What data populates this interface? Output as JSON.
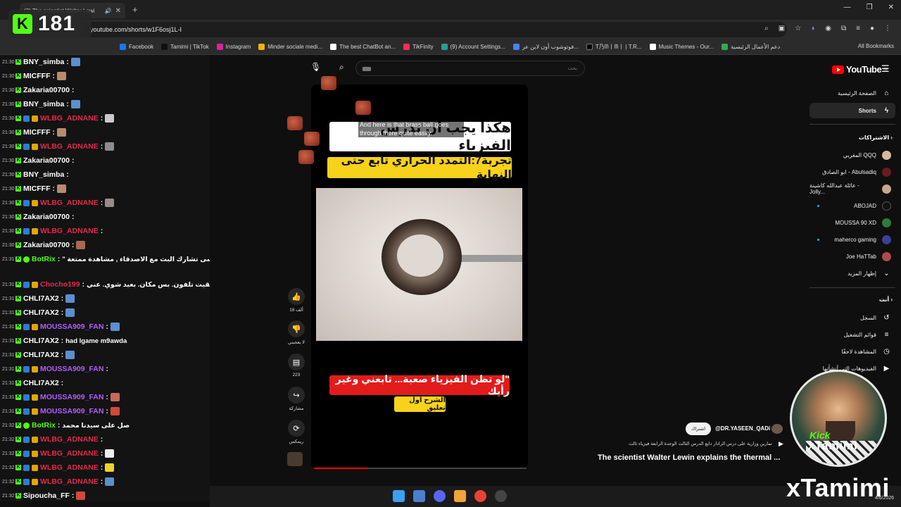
{
  "browser": {
    "tab_title": "(3) The scientist Walter Lewi",
    "url": "youtube.com/shorts/w1F6osj1L-I",
    "bookmarks": [
      "Facebook",
      "Tamimi | TikTok",
      "Instagram",
      "Minder sociale medi...",
      "The best ChatBot an...",
      "TikFinity",
      "(9) Account Settings...",
      "فوتوشوب أون لاين عر...",
      "T乃ᗰ丨ᗰ丨 | T.R...",
      "Music Themes - Our...",
      "دعم الأعمال الرئيسية"
    ],
    "all_bookmarks": "All Bookmarks"
  },
  "kick_badge": {
    "logo": "K",
    "viewers": "181"
  },
  "chat": [
    {
      "time": "21:30",
      "user": "BNY_simba",
      "color": "#ffffff",
      "text": "",
      "badges": 1,
      "emote": "#5b8fd1"
    },
    {
      "time": "21:30",
      "user": "MICFFF",
      "color": "#ffffff",
      "text": "",
      "badges": 1,
      "emote": "#b98a6d"
    },
    {
      "time": "21:30",
      "user": "Zakaria00700",
      "color": "#ffffff",
      "text": "",
      "badges": 1,
      "emote": ""
    },
    {
      "time": "21:30",
      "user": "BNY_simba",
      "color": "#ffffff",
      "text": "",
      "badges": 1,
      "emote": "#5b8fd1"
    },
    {
      "time": "21:30",
      "user": "WLBG_ADNANE",
      "color": "#e7284a",
      "text": "",
      "badges": 3,
      "emote": "#c9c9c9"
    },
    {
      "time": "21:30",
      "user": "MICFFF",
      "color": "#ffffff",
      "text": "",
      "badges": 1,
      "emote": "#b98a6d"
    },
    {
      "time": "21:30",
      "user": "WLBG_ADNANE",
      "color": "#e7284a",
      "text": "",
      "badges": 3,
      "emote": "#8c8c8c"
    },
    {
      "time": "21:30",
      "user": "Zakaria00700",
      "color": "#ffffff",
      "text": "",
      "badges": 1,
      "emote": ""
    },
    {
      "time": "21:30",
      "user": "BNY_simba",
      "color": "#ffffff",
      "text": "",
      "badges": 1,
      "emote": ""
    },
    {
      "time": "21:30",
      "user": "MICFFF",
      "color": "#ffffff",
      "text": "",
      "badges": 1,
      "emote": "#b98a6d"
    },
    {
      "time": "21:30",
      "user": "WLBG_ADNANE",
      "color": "#e7284a",
      "text": "",
      "badges": 3,
      "emote": "#9a8a8a"
    },
    {
      "time": "21:30",
      "user": "Zakaria00700",
      "color": "#ffffff",
      "text": "",
      "badges": 1,
      "emote": ""
    },
    {
      "time": "21:30",
      "user": "WLBG_ADNANE",
      "color": "#e7284a",
      "text": "",
      "badges": 3,
      "emote": ""
    },
    {
      "time": "21:30",
      "user": "Zakaria00700",
      "color": "#ffffff",
      "text": "",
      "badges": 1,
      "emote": "#a8694f"
    },
    {
      "time": "21:31",
      "user": "BotRix",
      "color": "#53fc18",
      "text": "\" ما تنسى تشارك البث مع الاصدقاء , مشاهدة ممتعة",
      "badges": 2,
      "emote": ""
    },
    {
      "time": "21:31",
      "user": "Chocho199",
      "color": "#e7284a",
      "text": "لقيت تلفون. بس مكان. بعيد شوي. عني",
      "badges": 3,
      "emote": ""
    },
    {
      "time": "21:31",
      "user": "CHLI7AX2",
      "color": "#ffffff",
      "text": "",
      "badges": 1,
      "emote": "#5b8fd1"
    },
    {
      "time": "21:31",
      "user": "CHLI7AX2",
      "color": "#ffffff",
      "text": "",
      "badges": 1,
      "emote": "#5b8fd1"
    },
    {
      "time": "21:31",
      "user": "MOUSSA909_FAN",
      "color": "#b45cff",
      "text": "",
      "badges": 4,
      "emote": "#5b8fd1"
    },
    {
      "time": "21:31",
      "user": "CHLI7AX2",
      "color": "#ffffff",
      "text": "had lgame m9awda",
      "badges": 1,
      "emote": ""
    },
    {
      "time": "21:31",
      "user": "CHLI7AX2",
      "color": "#ffffff",
      "text": "",
      "badges": 1,
      "emote": "#5b8fd1"
    },
    {
      "time": "21:31",
      "user": "MOUSSA909_FAN",
      "color": "#b45cff",
      "text": "",
      "badges": 4,
      "emote": ""
    },
    {
      "time": "21:31",
      "user": "CHLI7AX2",
      "color": "#ffffff",
      "text": "",
      "badges": 1,
      "emote": ""
    },
    {
      "time": "21:31",
      "user": "MOUSSA909_FAN",
      "color": "#b45cff",
      "text": "",
      "badges": 4,
      "emote": "#c76a56"
    },
    {
      "time": "21:31",
      "user": "MOUSSA909_FAN",
      "color": "#b45cff",
      "text": "",
      "badges": 4,
      "emote": "#d14a3a"
    },
    {
      "time": "21:32",
      "user": "BotRix",
      "color": "#53fc18",
      "text": "صل على سيدنا محمد",
      "badges": 2,
      "emote": ""
    },
    {
      "time": "21:32",
      "user": "WLBG_ADNANE",
      "color": "#e7284a",
      "text": "",
      "badges": 3,
      "emote": ""
    },
    {
      "time": "21:32",
      "user": "WLBG_ADNANE",
      "color": "#e7284a",
      "text": "",
      "badges": 3,
      "emote": "#eeeeee"
    },
    {
      "time": "21:32",
      "user": "WLBG_ADNANE",
      "color": "#e7284a",
      "text": "",
      "badges": 3,
      "emote": "#f2d12a"
    },
    {
      "time": "21:32",
      "user": "WLBG_ADNANE",
      "color": "#e7284a",
      "text": "",
      "badges": 3,
      "emote": "#5b8fd1"
    },
    {
      "time": "21:32",
      "user": "Sipoucha_FF",
      "color": "#ffffff",
      "text": "",
      "badges": 1,
      "emote": "#d14a3a"
    }
  ],
  "youtube": {
    "logo": "YouTube",
    "logo_region": "BE",
    "search_placeholder": "بحث",
    "sidebar": {
      "home": "الصفحة الرئيسية",
      "shorts": "Shorts",
      "subscriptions_head": "الاشتراكات",
      "channels": [
        "المغربي QQQ",
        "ابو الصادق - Abulsadiq",
        "عائلة عبدالله كاشينة - Jolly...",
        "ABOJAD",
        "MOUSSA 90 XD",
        "maherco gaming",
        "Joe HaTTab"
      ],
      "show_more": "إظهار المزيد",
      "you_head": "أنت",
      "history": "السجل",
      "playlists": "قوائم التشغيل",
      "watch_later": "المشاهدة لاحقًا",
      "your_videos": "الفيديوهات التي أنشأتها"
    },
    "short": {
      "caption_en": "And here is that brass ball goes through there quite easily.",
      "banner_white": "هكذا يجب ان تدرس الفيزياء",
      "banner_yellow": "تجربة7:التمدد الحراري تابع حتى النهاية",
      "banner_red": "\"لو تظن الفيزياء صعبة... تابعني وغير رأيك",
      "banner_small": "الشرح اول تعليق",
      "progress": 0.25
    },
    "actions": {
      "likes": "16 ألف",
      "dislike": "لا يعجبني",
      "comments": "223",
      "share": "مشاركة",
      "remix": "ريمكس"
    },
    "channel": {
      "subscribe": "اشتراك",
      "handle": "@DR.YASEEN_QADi",
      "description": "تمارين وزارية على درس الرادار دايع الدرس الثالث الوحدة الرابعة فيزياء ثالث",
      "title": "The scientist Walter Lewin explains the thermal ..."
    }
  },
  "overlay": {
    "kick_label": "Kick",
    "streamer_tag": "xTamimi",
    "streamer_watermark": "xTamimi"
  },
  "taskbar": {
    "date": "4/6/2026"
  }
}
